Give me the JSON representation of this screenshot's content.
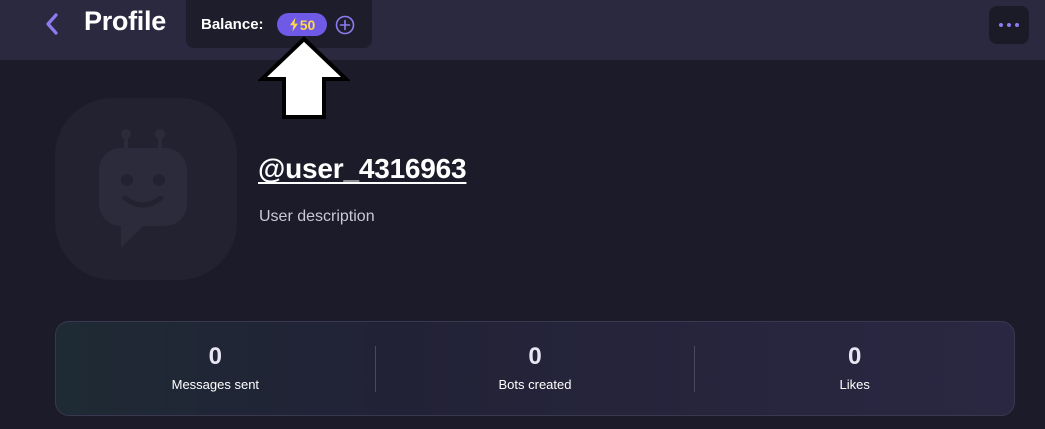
{
  "header": {
    "title": "Profile",
    "balance_label": "Balance:",
    "balance_value": "50",
    "icons": {
      "back": "chevron-left-icon",
      "bolt": "lightning-icon",
      "add": "plus-circle-icon",
      "more": "more-dots-icon"
    }
  },
  "profile": {
    "username": "@user_4316963",
    "description": "User description",
    "avatar_icon": "robot-chat-icon"
  },
  "stats": [
    {
      "value": "0",
      "label": "Messages sent"
    },
    {
      "value": "0",
      "label": "Bots created"
    },
    {
      "value": "0",
      "label": "Likes"
    }
  ],
  "colors": {
    "accent": "#8d7cf0",
    "pill": "#6f5ae8",
    "bolt": "#ffd84a",
    "header_bg": "#2b2940",
    "page_bg": "#1c1b29"
  }
}
